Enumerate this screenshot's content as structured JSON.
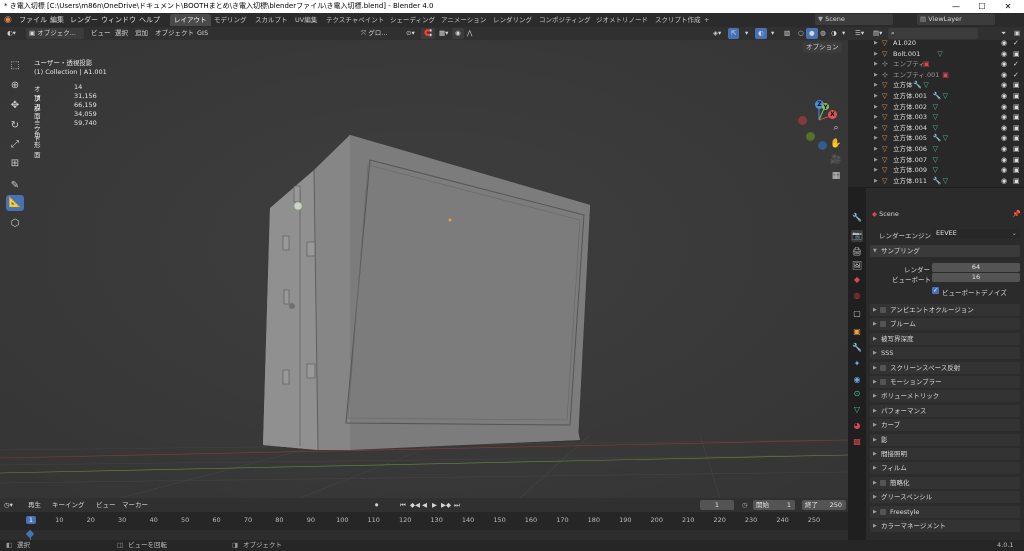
{
  "window": {
    "title": "* き電入切標 [C:\\Users\\m86n\\OneDrive\\ドキュメント\\BOOTHまとめ\\き電入切標\\blenderファイル\\き電入切標.blend] - Blender 4.0",
    "minimize": "—",
    "maximize": "☐",
    "close": "✕"
  },
  "menu": {
    "items": [
      "ファイル",
      "編集",
      "レンダー",
      "ウィンドウ",
      "ヘルプ"
    ]
  },
  "workspaces": {
    "tabs": [
      "レイアウト",
      "モデリング",
      "スカルプト",
      "UV編集",
      "テクスチャペイント",
      "シェーディング",
      "アニメーション",
      "レンダリング",
      "コンポジティング",
      "ジオメトリノード",
      "スクリプト作成"
    ],
    "active": "レイアウト",
    "add": "+",
    "scene": "Scene",
    "view_layer": "ViewLayer"
  },
  "viewport_header": {
    "mode": "オブジェク...",
    "view": "ビュー",
    "select": "選択",
    "add": "追加",
    "object": "オブジェクト",
    "gis": "GIS",
    "orientation": "グロ...",
    "options": "オプション"
  },
  "overlay": {
    "view_name": "ユーザー・透視投影",
    "collection": "(1) Collection | A1.001",
    "stats": [
      {
        "label": "オブジェクト",
        "value": "14"
      },
      {
        "label": "頂点",
        "value": "31,156"
      },
      {
        "label": "辺",
        "value": "66,159"
      },
      {
        "label": "面",
        "value": "34,059"
      },
      {
        "label": "三角形面",
        "value": "59,740"
      }
    ]
  },
  "gizmo": {
    "x": "X",
    "y": "Y",
    "z": "Z"
  },
  "outliner": {
    "rows": [
      {
        "name": "A1.020",
        "mod": false,
        "mesh": false,
        "cam": "check"
      },
      {
        "name": "Bolt.001",
        "mod": false,
        "mesh": true,
        "cam": "cam"
      },
      {
        "name": "エンプティ",
        "mod": false,
        "mesh": false,
        "cam": "check",
        "dim": true
      },
      {
        "name": "エンプティ.001",
        "mod": false,
        "mesh": false,
        "cam": "check",
        "dim": true
      },
      {
        "name": "立方体",
        "mod": true,
        "mesh": true,
        "cam": "cam"
      },
      {
        "name": "立方体.001",
        "mod": true,
        "mesh": true,
        "cam": "cam"
      },
      {
        "name": "立方体.002",
        "mod": false,
        "mesh": true,
        "cam": "cam"
      },
      {
        "name": "立方体.003",
        "mod": false,
        "mesh": true,
        "cam": "cam"
      },
      {
        "name": "立方体.004",
        "mod": false,
        "mesh": true,
        "cam": "cam"
      },
      {
        "name": "立方体.005",
        "mod": true,
        "mesh": true,
        "cam": "cam"
      },
      {
        "name": "立方体.006",
        "mod": false,
        "mesh": true,
        "cam": "cam"
      },
      {
        "name": "立方体.007",
        "mod": false,
        "mesh": true,
        "cam": "cam"
      },
      {
        "name": "立方体.009",
        "mod": false,
        "mesh": true,
        "cam": "cam"
      },
      {
        "name": "立方体.011",
        "mod": true,
        "mesh": true,
        "cam": "cam"
      }
    ]
  },
  "properties": {
    "scene": "Scene",
    "render_engine_label": "レンダーエンジン",
    "render_engine": "EEVEE",
    "sampling": {
      "title": "サンプリング",
      "render_label": "レンダー",
      "render_value": "64",
      "viewport_label": "ビューポート",
      "viewport_value": "16",
      "denoise_label": "ビューポートデノイズ",
      "denoise_checked": true
    },
    "panels": [
      {
        "label": "アンビエントオクルージョン",
        "checkbox": true
      },
      {
        "label": "ブルーム",
        "checkbox": true
      },
      {
        "label": "被写界深度",
        "checkbox": false
      },
      {
        "label": "SSS",
        "checkbox": false
      },
      {
        "label": "スクリーンスペース反射",
        "checkbox": true
      },
      {
        "label": "モーションブラー",
        "checkbox": true
      },
      {
        "label": "ボリューメトリック",
        "checkbox": false
      },
      {
        "label": "パフォーマンス",
        "checkbox": false
      },
      {
        "label": "カーブ",
        "checkbox": false
      },
      {
        "label": "影",
        "checkbox": false
      },
      {
        "label": "間接照明",
        "checkbox": false
      },
      {
        "label": "フィルム",
        "checkbox": false
      },
      {
        "label": "簡略化",
        "checkbox": true
      },
      {
        "label": "グリースペンシル",
        "checkbox": false
      },
      {
        "label": "Freestyle",
        "checkbox": true
      },
      {
        "label": "カラーマネージメント",
        "checkbox": false
      }
    ]
  },
  "timeline": {
    "playback": "再生",
    "keying": "キーイング",
    "view": "ビュー",
    "marker": "マーカー",
    "current_frame": "1",
    "start_label": "開始",
    "start": "1",
    "end_label": "終了",
    "end": "250",
    "ticks": [
      "1",
      "10",
      "20",
      "30",
      "40",
      "50",
      "60",
      "70",
      "80",
      "90",
      "100",
      "110",
      "120",
      "130",
      "140",
      "150",
      "160",
      "170",
      "180",
      "190",
      "200",
      "210",
      "220",
      "230",
      "240",
      "250"
    ]
  },
  "status": {
    "select": "選択",
    "rotate": "ビューを回転",
    "object": "オブジェクト",
    "version": "4.0.1"
  }
}
